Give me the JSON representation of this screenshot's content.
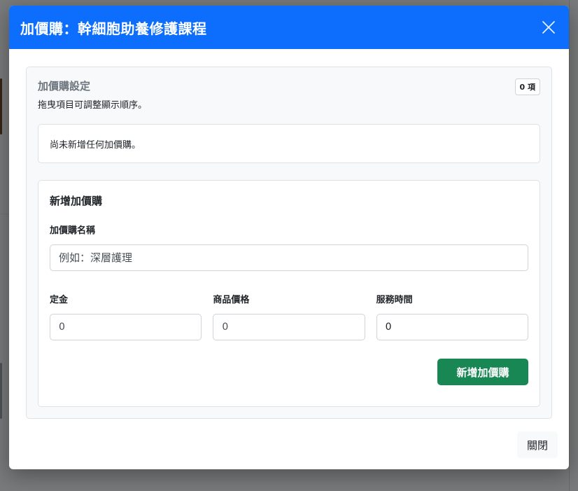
{
  "modal": {
    "title": "加價購：幹細胞助養修護課程",
    "close_icon": "close-icon"
  },
  "settings": {
    "title": "加價購設定",
    "hint": "拖曳項目可調整顯示順序。",
    "count_badge": "0 項",
    "empty_text": "尚未新增任何加價購。"
  },
  "add_form": {
    "title": "新增加價購",
    "name_label": "加價購名稱",
    "name_placeholder": "例如：深層護理",
    "name_value": "",
    "deposit_label": "定金",
    "deposit_value": "0",
    "price_label": "商品價格",
    "price_value": "0",
    "duration_label": "服務時間",
    "duration_value": "0",
    "submit_label": "新增加價購"
  },
  "footer": {
    "close_label": "關閉"
  },
  "colors": {
    "header": "#0d6efd",
    "submit": "#198754"
  }
}
